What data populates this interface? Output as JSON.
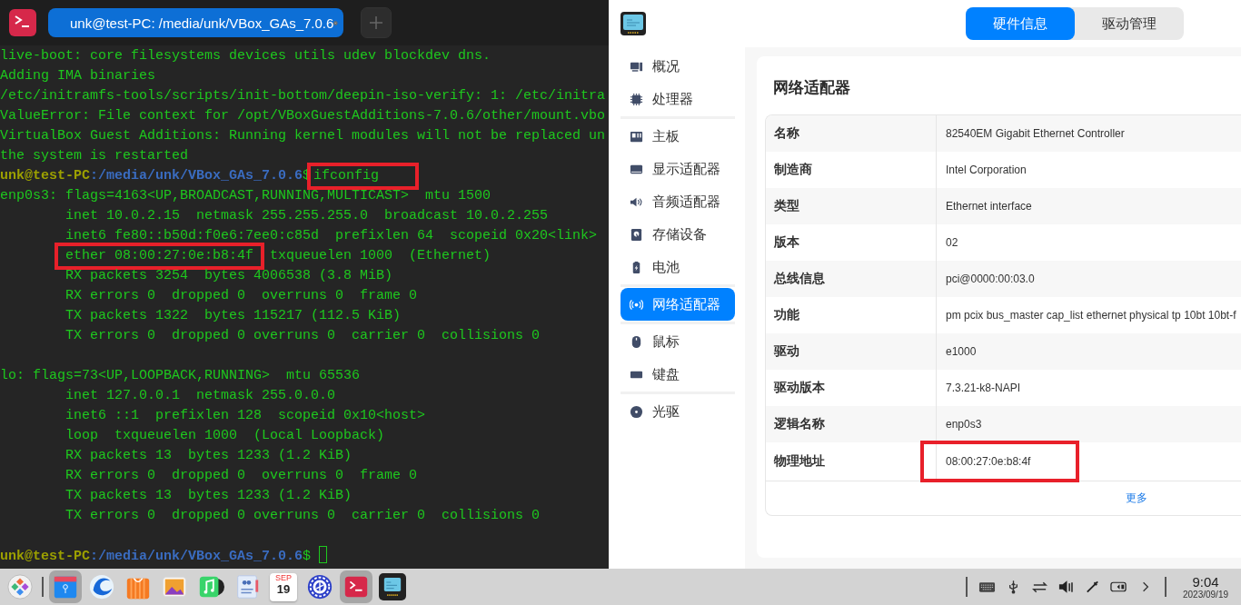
{
  "terminal": {
    "tab": {
      "title": "unk@test-PC: /media/unk/VBox_GAs_7.0.6",
      "selected": true
    },
    "lines": [
      {
        "kind": "output",
        "text": "live-boot: core filesystems devices utils udev blockdev dns."
      },
      {
        "kind": "output",
        "text": "Adding IMA binaries"
      },
      {
        "kind": "output",
        "text": "/etc/initramfs-tools/scripts/init-bottom/deepin-iso-verify: 1: /etc/initra"
      },
      {
        "kind": "output",
        "text": "ValueError: File context for /opt/VBoxGuestAdditions-7.0.6/other/mount.vbo"
      },
      {
        "kind": "output",
        "text": "VirtualBox Guest Additions: Running kernel modules will not be replaced un"
      },
      {
        "kind": "output",
        "text": "the system is restarted"
      },
      {
        "kind": "prompt",
        "user_host": "unk@test-PC",
        "separator": ":",
        "path": "/media/unk/VBox_GAs_7.0.6",
        "symbol": "$",
        "command": "ifconfig",
        "highlighted": true
      },
      {
        "kind": "output",
        "text": "enp0s3: flags=4163<UP,BROADCAST,RUNNING,MULTICAST>  mtu 1500"
      },
      {
        "kind": "output",
        "text": "        inet 10.0.2.15  netmask 255.255.255.0  broadcast 10.0.2.255"
      },
      {
        "kind": "output",
        "text": "        inet6 fe80::b50d:f0e6:7ee0:c85d  prefixlen 64  scopeid 0x20<link>"
      },
      {
        "kind": "output",
        "segments": [
          {
            "text": "        ether 08:00:27:0e:b8:4f",
            "highlighted": true
          },
          {
            "text": "  txqueuelen 1000  (Ethernet)",
            "highlighted": false
          }
        ]
      },
      {
        "kind": "output",
        "text": "        RX packets 3254  bytes 4006538 (3.8 MiB)"
      },
      {
        "kind": "output",
        "text": "        RX errors 0  dropped 0  overruns 0  frame 0"
      },
      {
        "kind": "output",
        "text": "        TX packets 1322  bytes 115217 (112.5 KiB)"
      },
      {
        "kind": "output",
        "text": "        TX errors 0  dropped 0 overruns 0  carrier 0  collisions 0"
      },
      {
        "kind": "blank"
      },
      {
        "kind": "output",
        "text": "lo: flags=73<UP,LOOPBACK,RUNNING>  mtu 65536"
      },
      {
        "kind": "output",
        "text": "        inet 127.0.0.1  netmask 255.0.0.0"
      },
      {
        "kind": "output",
        "text": "        inet6 ::1  prefixlen 128  scopeid 0x10<host>"
      },
      {
        "kind": "output",
        "text": "        loop  txqueuelen 1000  (Local Loopback)"
      },
      {
        "kind": "output",
        "text": "        RX packets 13  bytes 1233 (1.2 KiB)"
      },
      {
        "kind": "output",
        "text": "        RX errors 0  dropped 0  overruns 0  frame 0"
      },
      {
        "kind": "output",
        "text": "        TX packets 13  bytes 1233 (1.2 KiB)"
      },
      {
        "kind": "output",
        "text": "        TX errors 0  dropped 0 overruns 0  carrier 0  collisions 0"
      },
      {
        "kind": "blank"
      },
      {
        "kind": "prompt",
        "user_host": "unk@test-PC",
        "separator": ":",
        "path": "/media/unk/VBox_GAs_7.0.6",
        "symbol": "$",
        "cursor": true
      }
    ]
  },
  "device_manager": {
    "tabs": [
      {
        "label": "硬件信息",
        "selected": true
      },
      {
        "label": "驱动管理",
        "selected": false
      }
    ],
    "sidebar": {
      "groups": [
        {
          "items": [
            {
              "label": "概况",
              "selected": false
            },
            {
              "label": "处理器",
              "selected": false
            }
          ]
        },
        {
          "items": [
            {
              "label": "主板",
              "selected": false
            },
            {
              "label": "显示适配器",
              "selected": false
            },
            {
              "label": "音频适配器",
              "selected": false
            },
            {
              "label": "存储设备",
              "selected": false
            },
            {
              "label": "电池",
              "selected": false
            }
          ]
        },
        {
          "items": [
            {
              "label": "网络适配器",
              "selected": true
            }
          ]
        },
        {
          "items": [
            {
              "label": "鼠标",
              "selected": false
            },
            {
              "label": "键盘",
              "selected": false
            }
          ]
        },
        {
          "items": [
            {
              "label": "光驱",
              "selected": false
            }
          ]
        }
      ]
    },
    "detail": {
      "title": "网络适配器",
      "rows": [
        {
          "label": "名称",
          "value": "82540EM Gigabit Ethernet Controller",
          "highlighted": false
        },
        {
          "label": "制造商",
          "value": "Intel Corporation",
          "highlighted": false
        },
        {
          "label": "类型",
          "value": "Ethernet interface",
          "highlighted": false
        },
        {
          "label": "版本",
          "value": "02",
          "highlighted": false
        },
        {
          "label": "总线信息",
          "value": "pci@0000:00:03.0",
          "highlighted": false
        },
        {
          "label": "功能",
          "value": "pm pcix bus_master cap_list ethernet physical tp 10bt 10bt-f",
          "highlighted": false
        },
        {
          "label": "驱动",
          "value": "e1000",
          "highlighted": false
        },
        {
          "label": "驱动版本",
          "value": "7.3.21-k8-NAPI",
          "highlighted": false
        },
        {
          "label": "逻辑名称",
          "value": "enp0s3",
          "highlighted": false
        },
        {
          "label": "物理地址",
          "value": "08:00:27:0e:b8:4f",
          "highlighted": true
        }
      ],
      "more_link": "更多"
    }
  },
  "taskbar": {
    "apps": [
      {
        "active": false
      },
      {
        "active": true
      },
      {
        "active": false
      },
      {
        "active": false
      },
      {
        "active": false
      },
      {
        "active": false
      },
      {
        "active": false
      },
      {
        "active": false,
        "month": "SEP",
        "day": "19"
      },
      {
        "active": false
      },
      {
        "active": true
      },
      {
        "active": false
      }
    ],
    "clock": {
      "time": "9:04",
      "date": "2023/09/19"
    }
  }
}
